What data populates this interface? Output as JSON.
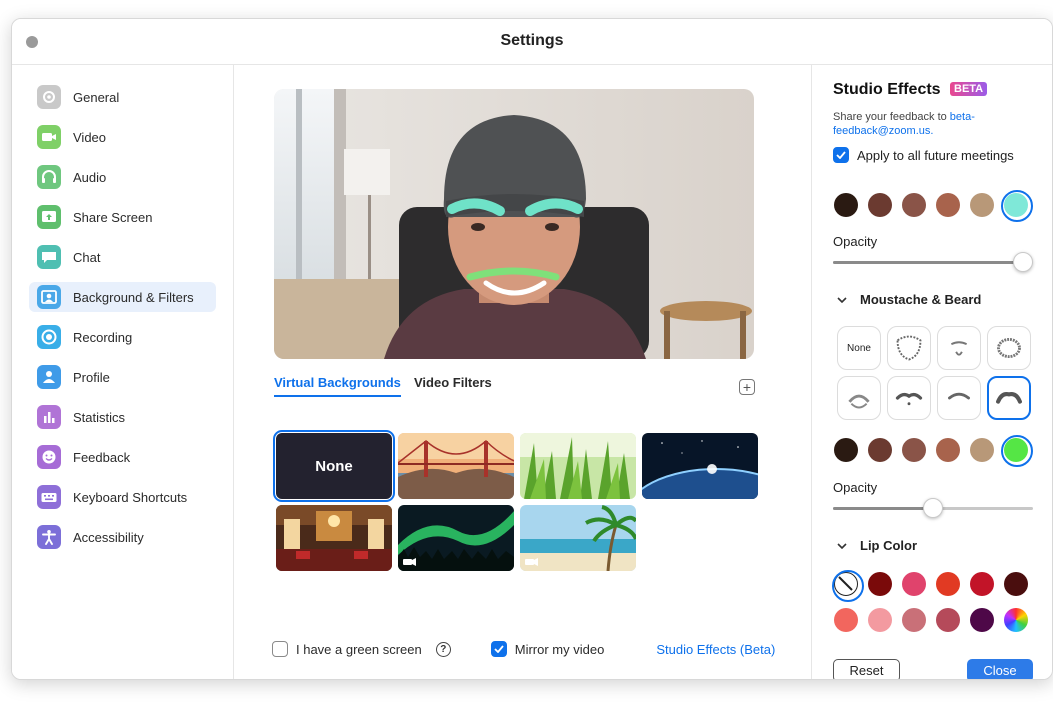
{
  "window": {
    "title": "Settings"
  },
  "sidebar": {
    "items": [
      {
        "label": "General",
        "icon": "gear-icon",
        "color": "#c9c9c9"
      },
      {
        "label": "Video",
        "icon": "video-camera-icon",
        "color": "#7fd067"
      },
      {
        "label": "Audio",
        "icon": "headphones-icon",
        "color": "#6fc77f"
      },
      {
        "label": "Share Screen",
        "icon": "share-screen-icon",
        "color": "#5fbf6d"
      },
      {
        "label": "Chat",
        "icon": "chat-bubble-icon",
        "color": "#4fbfb2"
      },
      {
        "label": "Background & Filters",
        "icon": "person-background-icon",
        "color": "#4aa8e8"
      },
      {
        "label": "Recording",
        "icon": "record-circle-icon",
        "color": "#39aee8"
      },
      {
        "label": "Profile",
        "icon": "person-icon",
        "color": "#3f9be8"
      },
      {
        "label": "Statistics",
        "icon": "bar-chart-icon",
        "color": "#b074d6"
      },
      {
        "label": "Feedback",
        "icon": "smiley-face-icon",
        "color": "#a66cd6"
      },
      {
        "label": "Keyboard Shortcuts",
        "icon": "keyboard-icon",
        "color": "#8e6fd8"
      },
      {
        "label": "Accessibility",
        "icon": "accessibility-icon",
        "color": "#7c6fd8"
      }
    ],
    "active_index": 5
  },
  "center": {
    "tabs": [
      "Virtual Backgrounds",
      "Video Filters"
    ],
    "active_tab": 0,
    "backgrounds": [
      {
        "label": "None",
        "kind": "none"
      },
      {
        "kind": "golden-gate-bridge"
      },
      {
        "kind": "grass"
      },
      {
        "kind": "earth-from-space"
      },
      {
        "kind": "lobby"
      },
      {
        "kind": "aurora",
        "video": true
      },
      {
        "kind": "beach",
        "video": true
      }
    ],
    "selected_background": 0,
    "green_screen_label": "I have a green screen",
    "green_screen_checked": false,
    "mirror_label": "Mirror my video",
    "mirror_checked": true,
    "studio_effects_link": "Studio Effects (Beta)"
  },
  "studio": {
    "title": "Studio Effects",
    "beta_badge": "BETA",
    "feedback_prefix": "Share your feedback to ",
    "feedback_email": "beta-feedback@zoom.us.",
    "apply_label": "Apply to all future meetings",
    "apply_checked": true,
    "eyebrow_colors": [
      "#2a1a12",
      "#6b3a30",
      "#8a5448",
      "#a8634c",
      "#b89878",
      "#7fe8d8"
    ],
    "eyebrow_selected": 5,
    "opacity_label": "Opacity",
    "eyebrow_opacity": 0.95,
    "moustache_title": "Moustache & Beard",
    "moustache_none_label": "None",
    "moustache_styles": [
      "none",
      "full-beard",
      "goatee",
      "circle-beard",
      "chevron",
      "handlebar",
      "pencil",
      "walrus"
    ],
    "moustache_selected": 7,
    "moustache_colors": [
      "#2a1a12",
      "#6b3a30",
      "#8a5448",
      "#a8634c",
      "#b89878",
      "#55e645"
    ],
    "moustache_color_selected": 5,
    "moustache_opacity": 0.5,
    "lip_title": "Lip Color",
    "lip_colors": [
      "none",
      "#7a0a0a",
      "#e0436c",
      "#e13a23",
      "#c21428",
      "#4a0e0e",
      "#f2665e",
      "#f39aa0",
      "#c97078",
      "#b54a5a",
      "#4e0848",
      "rainbow"
    ],
    "lip_selected": 0,
    "reset_label": "Reset",
    "close_label": "Close"
  }
}
